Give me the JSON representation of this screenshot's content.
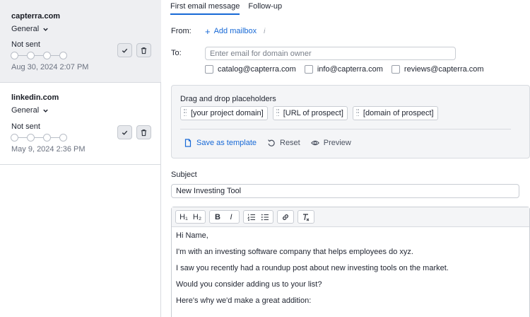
{
  "sidebar": {
    "cards": [
      {
        "domain": "capterra.com",
        "category": "General",
        "status": "Not sent",
        "date": "Aug 30, 2024 2:07 PM",
        "active": true
      },
      {
        "domain": "linkedin.com",
        "category": "General",
        "status": "Not sent",
        "date": "May 9, 2024 2:36 PM",
        "active": false
      }
    ]
  },
  "tabs": [
    {
      "label": "First email message",
      "active": true
    },
    {
      "label": "Follow-up",
      "active": false
    }
  ],
  "from": {
    "label": "From:",
    "add_mailbox": "Add mailbox",
    "info": "i"
  },
  "to": {
    "label": "To:",
    "placeholder": "Enter email for domain owner",
    "suggestions": [
      "catalog@capterra.com",
      "info@capterra.com",
      "reviews@capterra.com"
    ]
  },
  "placeholders": {
    "title": "Drag and drop placeholders",
    "chips": [
      "[your project domain]",
      "[URL of prospect]",
      "[domain of prospect]"
    ],
    "actions": {
      "save_template": "Save as template",
      "reset": "Reset",
      "preview": "Preview"
    }
  },
  "subject": {
    "label": "Subject",
    "value": "New Investing Tool"
  },
  "editor": {
    "toolbar": {
      "h1": "H₁",
      "h2": "H₂",
      "bold": "B",
      "italic": "I"
    },
    "body": [
      "Hi Name,",
      "I'm with an investing software company that helps employees do xyz.",
      "I saw you recently had a roundup post about new investing tools on the market.",
      "Would you consider adding us to your list?",
      "Here's why we'd make a great addition:"
    ]
  },
  "colors": {
    "accent": "#1769d6",
    "active_card_bg": "#eeeff2",
    "border": "#c9cdd3"
  }
}
